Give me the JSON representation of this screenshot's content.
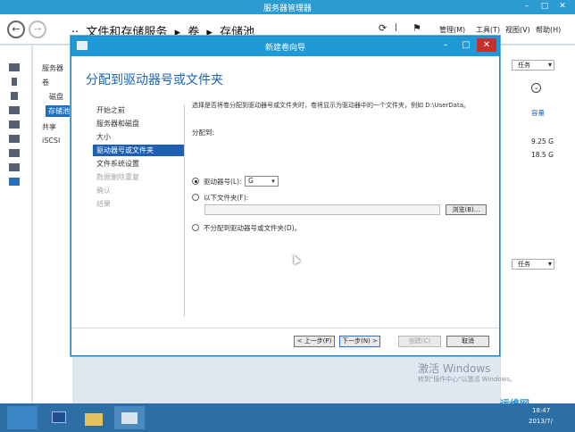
{
  "server_manager": {
    "title": "服务器管理器",
    "breadcrumb": [
      "··",
      "文件和存储服务",
      "▸",
      "卷",
      "▸",
      "存储池"
    ],
    "menu": [
      "管理(M)",
      "工具(T)",
      "视图(V)",
      "帮助(H)"
    ],
    "nav": [
      "服务器",
      "卷",
      "磁盘",
      "存储池",
      "共享",
      "iSCSI"
    ],
    "right_panel": {
      "tasks_label": "任务",
      "capacity_header": "容量",
      "capacity_values": [
        "9.25 G",
        "18.5 G"
      ]
    }
  },
  "wizard": {
    "title": "新建卷向导",
    "heading": "分配到驱动器号或文件夹",
    "steps": [
      {
        "label": "开始之前",
        "state": "normal"
      },
      {
        "label": "服务器和磁盘",
        "state": "normal"
      },
      {
        "label": "大小",
        "state": "normal"
      },
      {
        "label": "驱动器号或文件夹",
        "state": "active"
      },
      {
        "label": "文件系统设置",
        "state": "normal"
      },
      {
        "label": "数据删除重复",
        "state": "disabled"
      },
      {
        "label": "确认",
        "state": "disabled"
      },
      {
        "label": "结果",
        "state": "disabled"
      }
    ],
    "description": "选择是否将卷分配到驱动器号或文件夹时，卷将显示为驱动器中的一个文件夹，例如 D:\\UserData。",
    "assign_to_label": "分配到:",
    "option_drive_letter": "驱动器号(L):",
    "drive_letter_value": "G",
    "option_folder": "以下文件夹(F):",
    "folder_value": "",
    "browse_label": "浏览(B)...",
    "option_none": "不分配到驱动器号或文件夹(D)。",
    "selected_option": "drive_letter",
    "buttons": {
      "prev": "< 上一步(P)",
      "next": "下一步(N) >",
      "create": "创建(C)",
      "cancel": "取消"
    }
  },
  "watermark": {
    "line1": "激活 Windows",
    "line2": "转到\"操作中心\"以激活 Windows。"
  },
  "logo_text": "运维网",
  "taskbar": {
    "time": "18:47",
    "date": "2013/7/"
  }
}
